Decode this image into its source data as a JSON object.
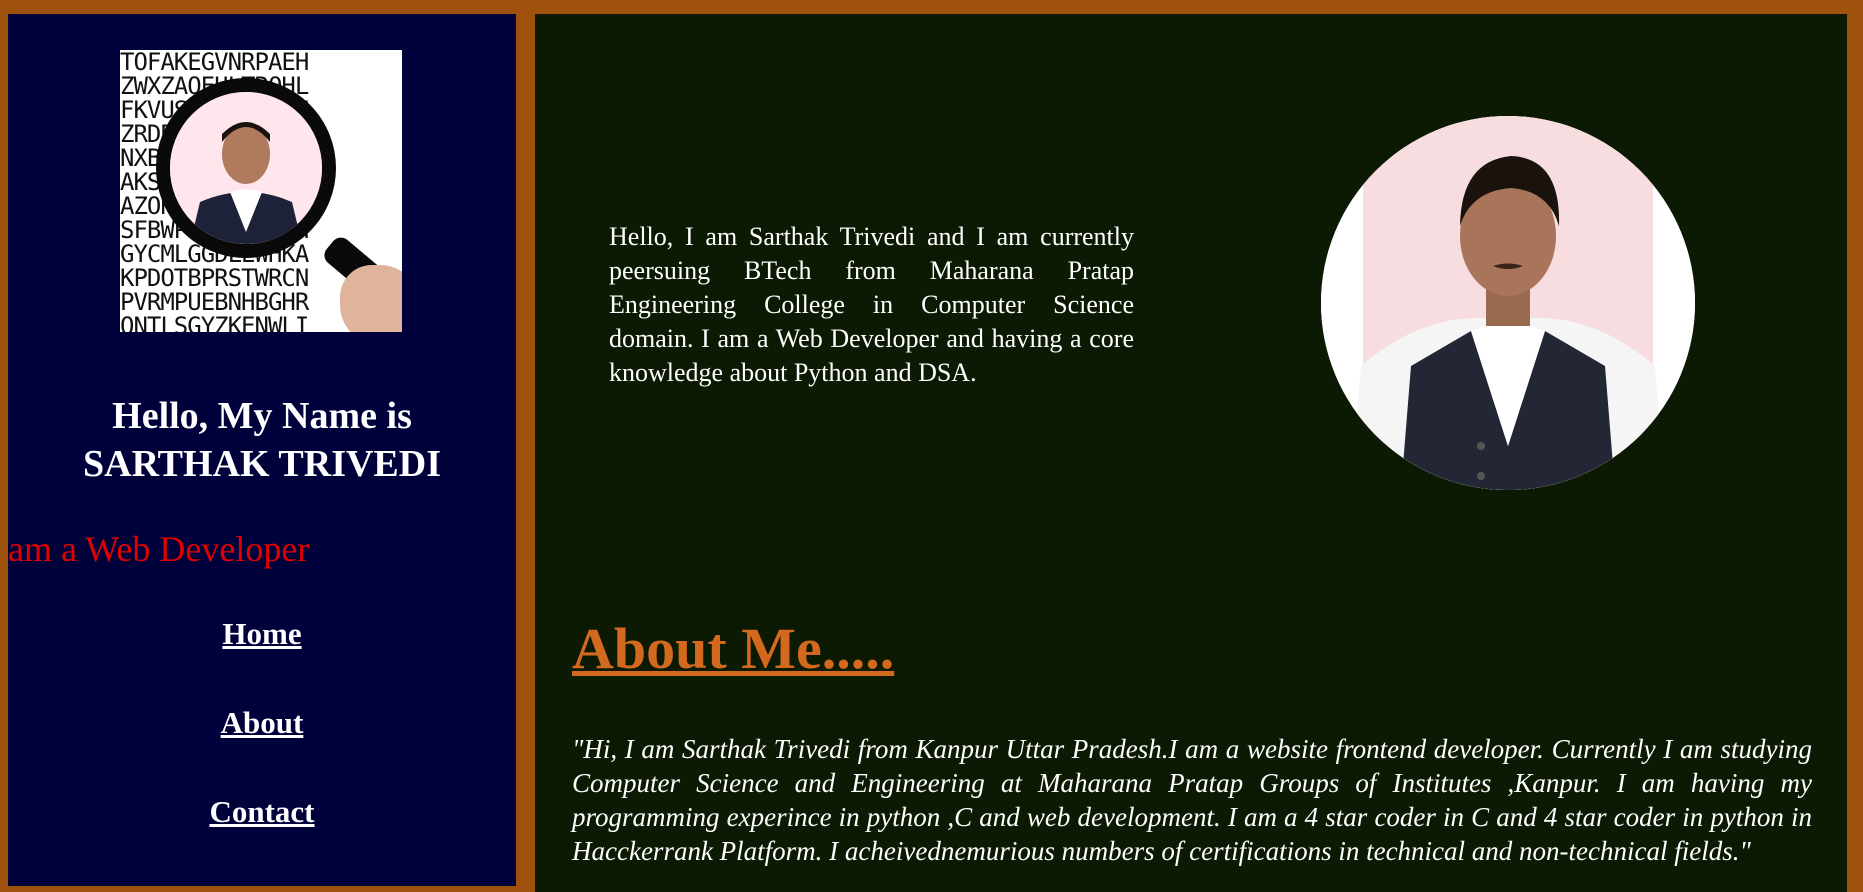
{
  "sidebar": {
    "logo_letters": [
      "TOFAKEGVNRPAEH",
      "ZWXZAOEULTROHL",
      "FKVUSNGSPTAYCH",
      "ZRDBGMHCJOIYOV",
      "NXBLJSWCFPIIBM",
      "AKSIYQHTTSZPHO",
      "AZONITECUJPKUH",
      "SFBWPBBTANNEIH",
      "GYCMLGGDLEWHKA",
      "KPDOTBPRSTWRCN",
      "PVRMPUEBNHBGHR",
      "ONTLSGYZKENWLI"
    ],
    "title_line1": "Hello, My Name is",
    "title_line2": "SARTHAK TRIVEDI",
    "typing_text": "am a Web Developer",
    "nav": [
      "Home",
      "About",
      "Contact"
    ]
  },
  "main": {
    "intro": "Hello, I am Sarthak Trivedi and I am currently peersuing BTech from Maharana Pratap Engineering College in Computer Science domain. I am a Web Developer and having a core knowledge about Python and DSA.",
    "about_heading": "About Me.....",
    "about_text": "\"Hi, I am Sarthak Trivedi from Kanpur Uttar Pradesh.I am a website frontend developer. Currently I am studying Computer Science and Engineering at Maharana Pratap Groups of Institutes ,Kanpur. I am having my programming experince in python ,C and web development. I am a 4 star coder in C and 4 star coder in python in Hacckerrank Platform. I acheivednemurious numbers of certifications in technical and non-technical fields.\""
  },
  "colors": {
    "frame": "#a0520c",
    "sidebar_bg": "#00003a",
    "main_bg": "#0c1a03",
    "typing": "#e00000",
    "about_heading": "#d2691e"
  }
}
